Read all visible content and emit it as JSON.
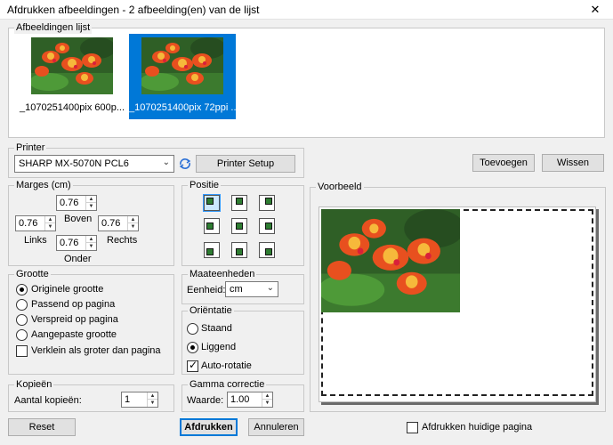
{
  "window": {
    "title": "Afdrukken afbeeldingen  - 2 afbeelding(en) van de lijst",
    "close_glyph": "✕"
  },
  "images_list": {
    "label": "Afbeeldingen lijst",
    "items": [
      {
        "caption": "_1070251400pix 600p...",
        "selected": false
      },
      {
        "caption": "_1070251400pix 72ppi ...",
        "selected": true
      }
    ]
  },
  "printer": {
    "label": "Printer",
    "selected": "SHARP MX-5070N PCL6",
    "setup_label": "Printer Setup",
    "refresh_icon": "refresh-icon"
  },
  "list_buttons": {
    "add_label": "Toevoegen",
    "clear_label": "Wissen"
  },
  "margins": {
    "label": "Marges (cm)",
    "top": "0.76",
    "top_label": "Boven",
    "left": "0.76",
    "left_label": "Links",
    "right": "0.76",
    "right_label": "Rechts",
    "bottom": "0.76",
    "bottom_label": "Onder"
  },
  "position": {
    "label": "Positie",
    "selected_index": 0
  },
  "size": {
    "label": "Grootte",
    "options": [
      "Originele grootte",
      "Passend op pagina",
      "Verspreid op pagina",
      "Aangepaste grootte"
    ],
    "selected_index": 0,
    "shrink_label": "Verklein als groter dan pagina",
    "shrink_checked": false
  },
  "units": {
    "label": "Maateenheden",
    "unit_label": "Eenheid:",
    "unit_value": "cm"
  },
  "orientation": {
    "label": "Oriëntatie",
    "portrait_label": "Staand",
    "landscape_label": "Liggend",
    "selected": "landscape",
    "autorotate_label": "Auto-rotatie",
    "autorotate_checked": true
  },
  "copies": {
    "label": "Kopieën",
    "count_label": "Aantal kopieën:",
    "count_value": "1"
  },
  "gamma": {
    "label": "Gamma correctie",
    "value_label": "Waarde:",
    "value": "1.00"
  },
  "preview": {
    "label": "Voorbeeld"
  },
  "footer": {
    "reset_label": "Reset",
    "print_label": "Afdrukken",
    "cancel_label": "Annuleren",
    "current_page_label": "Afdrukken huidige pagina",
    "current_page_checked": false
  }
}
